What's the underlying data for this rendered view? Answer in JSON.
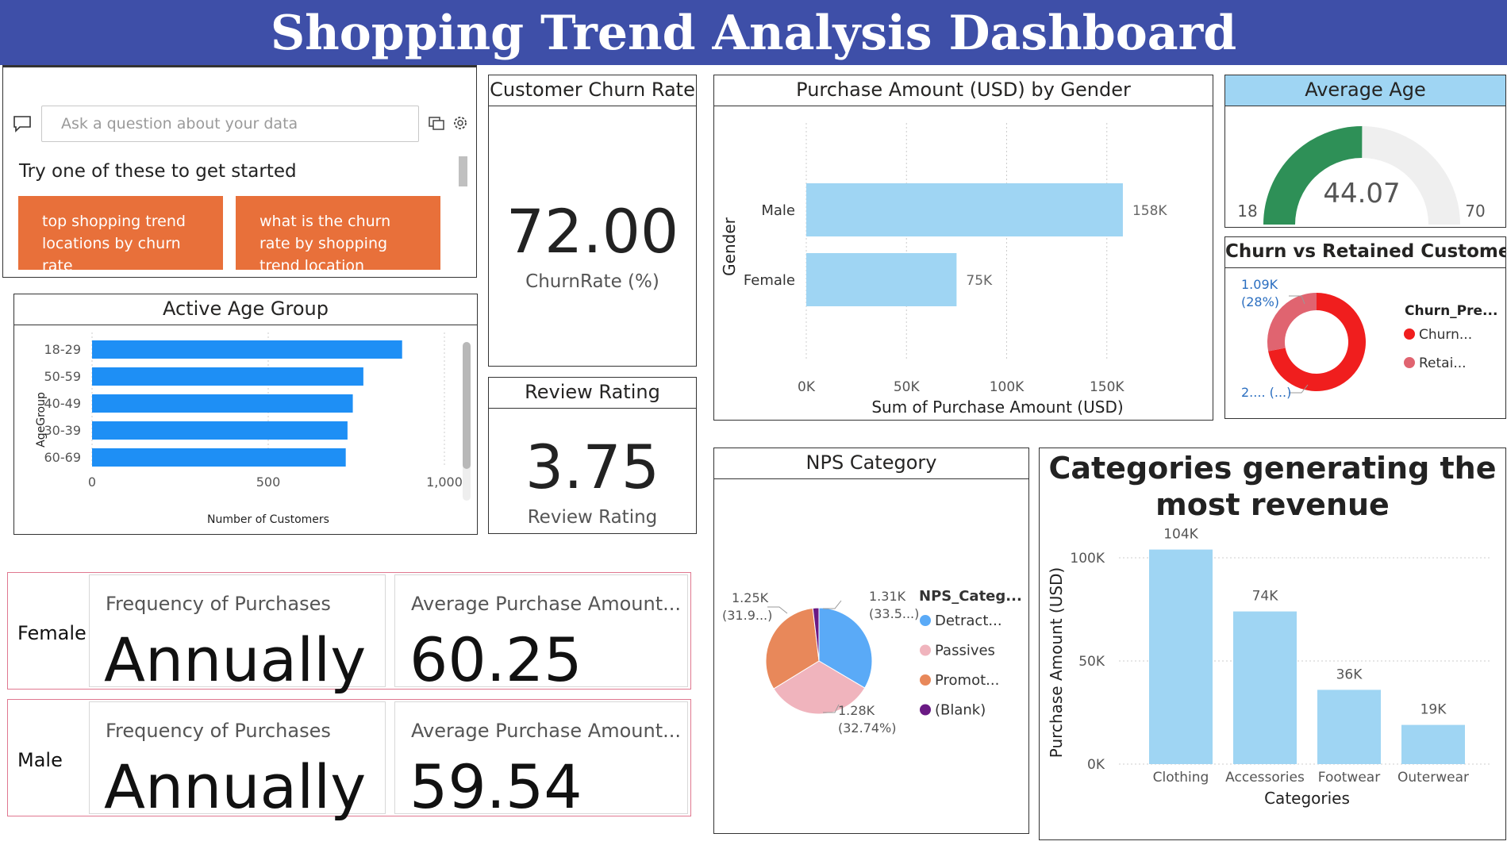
{
  "dashboard": {
    "title": "Shopping Trend Analysis Dashboard"
  },
  "qa": {
    "placeholder": "Ask a question about your data",
    "prompt": "Try one of these to get started",
    "suggestions": [
      "top shopping trend locations by churn rate",
      "what is the churn rate by shopping trend location"
    ]
  },
  "churn_card": {
    "title": "Customer Churn Rate",
    "value": "72.00",
    "label": "ChurnRate (%)"
  },
  "review_card": {
    "title": "Review Rating",
    "value": "3.75",
    "label": "Review Rating"
  },
  "avg_age": {
    "title": "Average Age",
    "value": "44.07",
    "min": "18",
    "max": "70",
    "fill_fraction": 0.501,
    "colors": {
      "fill": "#2e9057",
      "track": "#efefef"
    }
  },
  "colors": {
    "banner": "#3e4fa8",
    "suggestion": "#e8703a",
    "bar_blue": "#1e8ff5",
    "bar_light": "#9fd5f3",
    "gender_border": "#e07890"
  },
  "gender_cards": [
    {
      "gender": "Female",
      "freq_label": "Frequency of Purchases",
      "freq_value": "Annually",
      "avg_label": "Average Purchase Amount...",
      "avg_value": "60.25"
    },
    {
      "gender": "Male",
      "freq_label": "Frequency of Purchases",
      "freq_value": "Annually",
      "avg_label": "Average Purchase Amount...",
      "avg_value": "59.54"
    }
  ],
  "chart_data": [
    {
      "id": "active-age",
      "type": "bar",
      "orientation": "horizontal",
      "title": "Active Age Group",
      "ylabel": "AgeGroup",
      "xlabel": "Number of Customers",
      "categories": [
        "18-29",
        "50-59",
        "40-49",
        "30-39",
        "60-69"
      ],
      "values": [
        880,
        770,
        740,
        725,
        720
      ],
      "xlim": [
        0,
        1000
      ],
      "ticks": [
        "0",
        "500",
        "1,000"
      ],
      "color": "#1e8ff5"
    },
    {
      "id": "gender-purchase",
      "type": "bar",
      "orientation": "horizontal",
      "title": "Purchase Amount (USD) by Gender",
      "ylabel": "Gender",
      "xlabel": "Sum of Purchase Amount (USD)",
      "categories": [
        "Male",
        "Female"
      ],
      "values": [
        158000,
        75000
      ],
      "data_labels": [
        "158K",
        "75K"
      ],
      "xlim": [
        0,
        160000
      ],
      "ticks": [
        "0K",
        "50K",
        "100K",
        "150K"
      ],
      "color": "#9fd5f3"
    },
    {
      "id": "churn-donut",
      "type": "pie",
      "title": "Churn vs Retained Customers",
      "legend_title": "Churn_Pre...",
      "legend": [
        "Churn...",
        "Retai..."
      ],
      "values": [
        72,
        28
      ],
      "data_labels": [
        "2.... (...)",
        "1.09K",
        "(28%)"
      ],
      "colors": [
        "#f01e1e",
        "#e06470"
      ]
    },
    {
      "id": "nps-pie",
      "type": "pie",
      "title": "NPS Category",
      "legend_title": "NPS_Categ...",
      "legend": [
        "Detract...",
        "Passives",
        "Promot...",
        "(Blank)"
      ],
      "values": [
        33.5,
        32.74,
        31.9,
        1.86
      ],
      "data_labels": [
        {
          "value": "1.31K",
          "pct": "(33.5...)"
        },
        {
          "value": "1.28K",
          "pct": "(32.74%)"
        },
        {
          "value": "1.25K",
          "pct": "(31.9...)"
        }
      ],
      "colors": [
        "#5aaaf7",
        "#f0b4bd",
        "#e8885a",
        "#6a1a84"
      ]
    },
    {
      "id": "revenue-categories",
      "type": "bar",
      "orientation": "vertical",
      "title": "Categories generating the most revenue",
      "xlabel": "Categories",
      "ylabel": "Purchase Amount (USD)",
      "categories": [
        "Clothing",
        "Accessories",
        "Footwear",
        "Outerwear"
      ],
      "values": [
        104000,
        74000,
        36000,
        19000
      ],
      "data_labels": [
        "104K",
        "74K",
        "36K",
        "19K"
      ],
      "ylim": [
        0,
        105000
      ],
      "ticks": [
        "0K",
        "50K",
        "100K"
      ],
      "color": "#9fd5f3"
    }
  ]
}
